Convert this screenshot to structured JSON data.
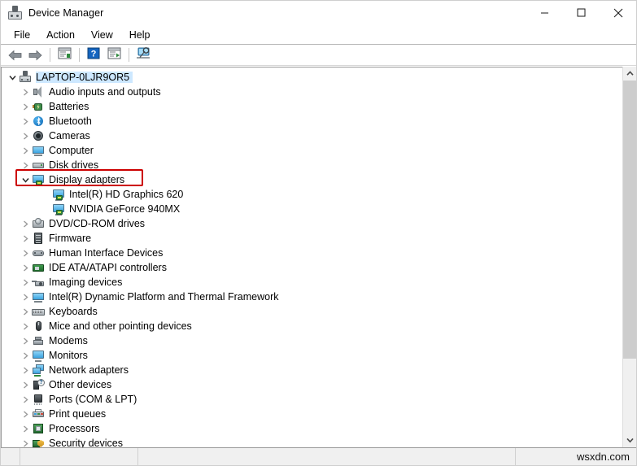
{
  "window": {
    "title": "Device Manager",
    "title_icon": "device-manager-icon",
    "controls": {
      "minimize": "minimize-icon",
      "maximize": "maximize-icon",
      "close": "close-icon"
    }
  },
  "menubar": {
    "items": [
      {
        "label": "File"
      },
      {
        "label": "Action"
      },
      {
        "label": "View"
      },
      {
        "label": "Help"
      }
    ]
  },
  "toolbar": {
    "buttons": [
      {
        "name": "back-button",
        "icon": "back-arrow-icon"
      },
      {
        "name": "forward-button",
        "icon": "forward-arrow-icon"
      },
      {
        "name": "properties-button",
        "icon": "properties-icon"
      },
      {
        "name": "help-button",
        "icon": "help-question-icon"
      },
      {
        "name": "update-driver-button",
        "icon": "update-driver-icon"
      },
      {
        "name": "scan-hardware-changes-button",
        "icon": "scan-hardware-icon"
      }
    ]
  },
  "tree": {
    "root": {
      "label": "LAPTOP-0LJR9OR5",
      "icon": "computer-node-icon",
      "expanded": true,
      "selected": true
    },
    "items": [
      {
        "label": "Audio inputs and outputs",
        "icon": "speaker-icon",
        "level": 1,
        "expanded": false
      },
      {
        "label": "Batteries",
        "icon": "battery-icon",
        "level": 1,
        "expanded": false
      },
      {
        "label": "Bluetooth",
        "icon": "bluetooth-icon",
        "level": 1,
        "expanded": false
      },
      {
        "label": "Cameras",
        "icon": "camera-icon",
        "level": 1,
        "expanded": false
      },
      {
        "label": "Computer",
        "icon": "computer-icon",
        "level": 1,
        "expanded": false
      },
      {
        "label": "Disk drives",
        "icon": "disk-drive-icon",
        "level": 1,
        "expanded": false
      },
      {
        "label": "Display adapters",
        "icon": "display-adapter-icon",
        "level": 1,
        "expanded": true,
        "highlighted": true
      },
      {
        "label": "Intel(R) HD Graphics 620",
        "icon": "display-adapter-icon",
        "level": 2
      },
      {
        "label": "NVIDIA GeForce 940MX",
        "icon": "display-adapter-icon",
        "level": 2
      },
      {
        "label": "DVD/CD-ROM drives",
        "icon": "dvd-drive-icon",
        "level": 1,
        "expanded": false
      },
      {
        "label": "Firmware",
        "icon": "firmware-chip-icon",
        "level": 1,
        "expanded": false
      },
      {
        "label": "Human Interface Devices",
        "icon": "hid-gamepad-icon",
        "level": 1,
        "expanded": false
      },
      {
        "label": "IDE ATA/ATAPI controllers",
        "icon": "ide-controller-icon",
        "level": 1,
        "expanded": false
      },
      {
        "label": "Imaging devices",
        "icon": "imaging-device-icon",
        "level": 1,
        "expanded": false
      },
      {
        "label": "Intel(R) Dynamic Platform and Thermal Framework",
        "icon": "computer-icon",
        "level": 1,
        "expanded": false
      },
      {
        "label": "Keyboards",
        "icon": "keyboard-icon",
        "level": 1,
        "expanded": false
      },
      {
        "label": "Mice and other pointing devices",
        "icon": "mouse-icon",
        "level": 1,
        "expanded": false
      },
      {
        "label": "Modems",
        "icon": "modem-icon",
        "level": 1,
        "expanded": false
      },
      {
        "label": "Monitors",
        "icon": "monitor-icon",
        "level": 1,
        "expanded": false
      },
      {
        "label": "Network adapters",
        "icon": "network-adapter-icon",
        "level": 1,
        "expanded": false
      },
      {
        "label": "Other devices",
        "icon": "unknown-device-icon",
        "level": 1,
        "expanded": false
      },
      {
        "label": "Ports (COM & LPT)",
        "icon": "port-icon",
        "level": 1,
        "expanded": false
      },
      {
        "label": "Print queues",
        "icon": "printer-icon",
        "level": 1,
        "expanded": false
      },
      {
        "label": "Processors",
        "icon": "processor-icon",
        "level": 1,
        "expanded": false
      },
      {
        "label": "Security devices",
        "icon": "security-device-icon",
        "level": 1,
        "expanded": false
      }
    ]
  },
  "highlight": {
    "color": "#cc0000",
    "target": "Display adapters"
  },
  "scrollbar": {
    "up_arrow": "chevron-up-icon",
    "down_arrow": "chevron-down-icon"
  },
  "statusbar": {
    "cell1": "",
    "cell2": "",
    "cell3": "",
    "watermark": "wsxdn.com"
  }
}
